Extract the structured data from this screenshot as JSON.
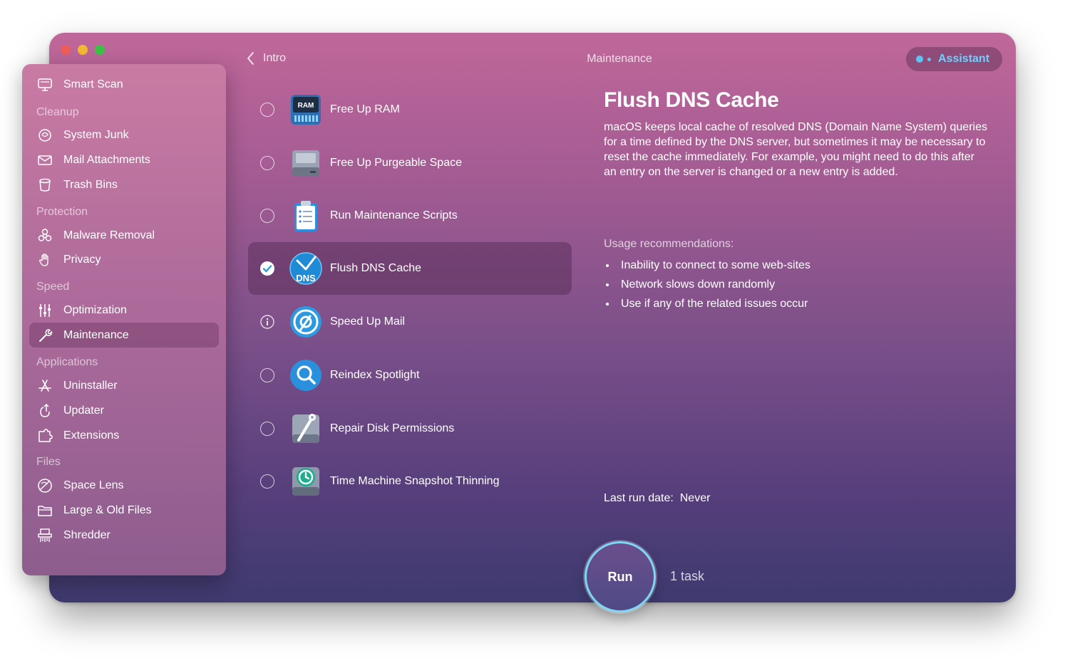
{
  "window": {
    "traffic_lights": [
      "close",
      "minimize",
      "zoom"
    ]
  },
  "sidebar": {
    "smart_scan": "Smart Scan",
    "sections": [
      {
        "title": "Cleanup",
        "items": [
          "System Junk",
          "Mail Attachments",
          "Trash Bins"
        ]
      },
      {
        "title": "Protection",
        "items": [
          "Malware Removal",
          "Privacy"
        ]
      },
      {
        "title": "Speed",
        "items": [
          "Optimization",
          "Maintenance"
        ]
      },
      {
        "title": "Applications",
        "items": [
          "Uninstaller",
          "Updater",
          "Extensions"
        ]
      },
      {
        "title": "Files",
        "items": [
          "Space Lens",
          "Large & Old Files",
          "Shredder"
        ]
      }
    ],
    "active_item": "Maintenance"
  },
  "topbar": {
    "back_label": "Intro",
    "title": "Maintenance",
    "assistant_label": "Assistant"
  },
  "tasks": [
    {
      "label": "Free Up RAM",
      "state": "unchecked",
      "icon": "ram-icon"
    },
    {
      "label": "Free Up Purgeable Space",
      "state": "unchecked",
      "icon": "drive-icon"
    },
    {
      "label": "Run Maintenance Scripts",
      "state": "unchecked",
      "icon": "clipboard-icon"
    },
    {
      "label": "Flush DNS Cache",
      "state": "checked",
      "icon": "dns-icon"
    },
    {
      "label": "Speed Up Mail",
      "state": "info",
      "icon": "mail-icon"
    },
    {
      "label": "Reindex Spotlight",
      "state": "unchecked",
      "icon": "spotlight-icon"
    },
    {
      "label": "Repair Disk Permissions",
      "state": "unchecked",
      "icon": "disk-repair-icon"
    },
    {
      "label": "Time Machine Snapshot Thinning",
      "state": "unchecked",
      "icon": "time-machine-icon"
    }
  ],
  "detail": {
    "title": "Flush DNS Cache",
    "description": "macOS keeps local cache of resolved DNS (Domain Name System) queries for a time defined by the DNS server, but sometimes it may be necessary to reset the cache immediately. For example, you might need to do this after an entry on the server is changed or a new entry is added.",
    "usage_label": "Usage recommendations:",
    "usage_items": [
      "Inability to connect to some web-sites",
      "Network slows down randomly",
      "Use if any of the related issues occur"
    ],
    "last_run": "Last run date:  Never"
  },
  "footer": {
    "run_label": "Run",
    "task_count": "1 task"
  },
  "colors": {
    "accent": "#5cc4f2",
    "run_ring": "#7fd6f5"
  }
}
